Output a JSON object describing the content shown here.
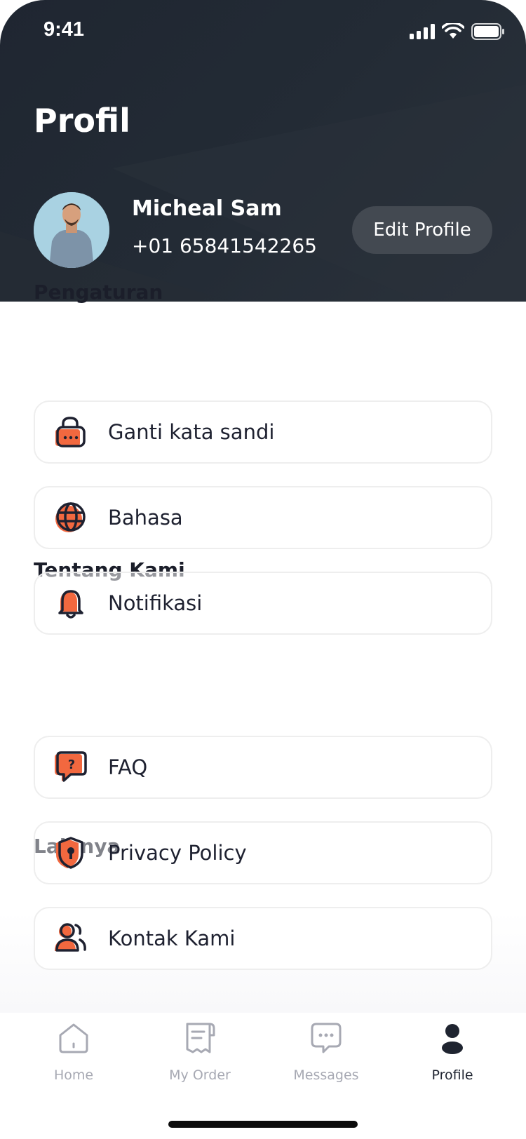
{
  "status_bar": {
    "time": "9:41",
    "icons": [
      "signal-icon",
      "wifi-icon",
      "battery-icon"
    ]
  },
  "header": {
    "title": "Profil"
  },
  "profile": {
    "name": "Micheal Sam",
    "phone": "+01 65841542265",
    "edit_button": "Edit Profile",
    "avatar": "avatar"
  },
  "sections": {
    "settings": {
      "label": "Pengaturan"
    },
    "about": {
      "label": "Tentang Kami"
    },
    "others": {
      "label": "Lainnya"
    }
  },
  "menu": [
    {
      "label": "Ganti kata sandi",
      "icon": "lock-icon"
    },
    {
      "label": "Bahasa",
      "icon": "globe-icon"
    },
    {
      "label": "Notifikasi",
      "icon": "bell-icon"
    },
    {
      "label": "FAQ",
      "icon": "faq-icon"
    },
    {
      "label": "Privacy Policy",
      "icon": "shield-icon"
    },
    {
      "label": "Kontak Kami",
      "icon": "contacts-icon"
    }
  ],
  "bottom_nav": [
    {
      "label": "Home",
      "icon": "home-icon",
      "active": false
    },
    {
      "label": "My Order",
      "icon": "receipt-icon",
      "active": false
    },
    {
      "label": "Messages",
      "icon": "chat-icon",
      "active": false
    },
    {
      "label": "Profile",
      "icon": "profile-icon",
      "active": true
    }
  ],
  "colors": {
    "header_bg": "#1f2631",
    "accent": "#f2683f",
    "text_dark": "#1e2130",
    "nav_inactive": "#a7a9b3",
    "edit_button_bg": "#434951"
  }
}
